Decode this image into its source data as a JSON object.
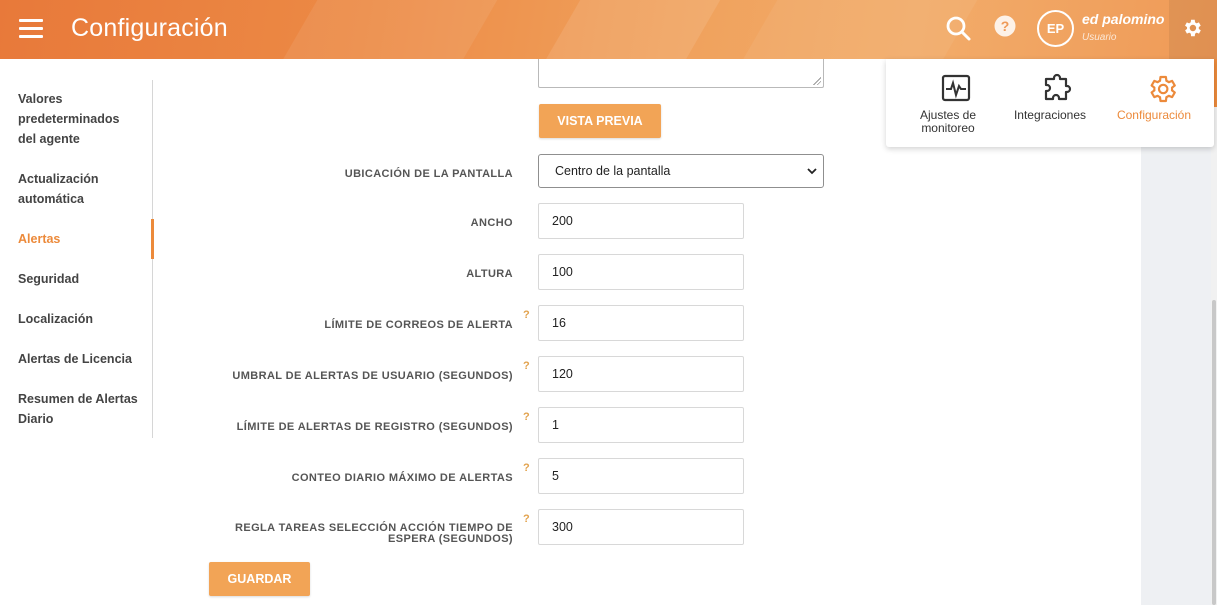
{
  "header": {
    "title": "Configuración",
    "user_initials": "EP",
    "user_name": "ed palomino",
    "user_role": "Usuario",
    "brand_color": "#ec8a3b"
  },
  "settings_menu": {
    "items": [
      {
        "label_line1": "Ajustes de",
        "label_line2": "monitoreo",
        "icon": "monitor-pulse-icon"
      },
      {
        "label": "Integraciones",
        "icon": "puzzle-icon"
      },
      {
        "label": "Configuración",
        "icon": "gear-icon",
        "active": true
      }
    ]
  },
  "sidebar": {
    "items": [
      {
        "line1": "Valores",
        "line2": "predeterminados",
        "line3": "del agente"
      },
      {
        "line1": "Actualización",
        "line2": "automática"
      },
      {
        "line1": "Alertas",
        "active": true
      },
      {
        "line1": "Seguridad"
      },
      {
        "line1": "Localización"
      },
      {
        "line1": "Alertas de Licencia"
      },
      {
        "line1": "Resumen de Alertas",
        "line2": "Diario"
      }
    ]
  },
  "form": {
    "preview_button": "VISTA PREVIA",
    "screen_location": {
      "label": "UBICACIÓN DE LA PANTALLA",
      "value": "Centro de la pantalla"
    },
    "width": {
      "label": "ANCHO",
      "value": "200"
    },
    "height": {
      "label": "ALTURA",
      "value": "100"
    },
    "email_limit": {
      "label": "LÍMITE DE CORREOS DE ALERTA",
      "value": "16",
      "help": "?"
    },
    "user_threshold": {
      "label": "UMBRAL DE ALERTAS DE USUARIO (SEGUNDOS)",
      "value": "120",
      "help": "?"
    },
    "log_limit": {
      "label": "LÍMITE DE ALERTAS DE REGISTRO (SEGUNDOS)",
      "value": "1",
      "help": "?"
    },
    "daily_max": {
      "label": "CONTEO DIARIO MÁXIMO DE ALERTAS",
      "value": "5",
      "help": "?"
    },
    "task_rule": {
      "label_line1": "REGLA TAREAS SELECCIÓN ACCIÓN TIEMPO DE",
      "label_line2": "ESPERA (SEGUNDOS)",
      "value": "300",
      "help": "?"
    },
    "save_button": "GUARDAR"
  }
}
